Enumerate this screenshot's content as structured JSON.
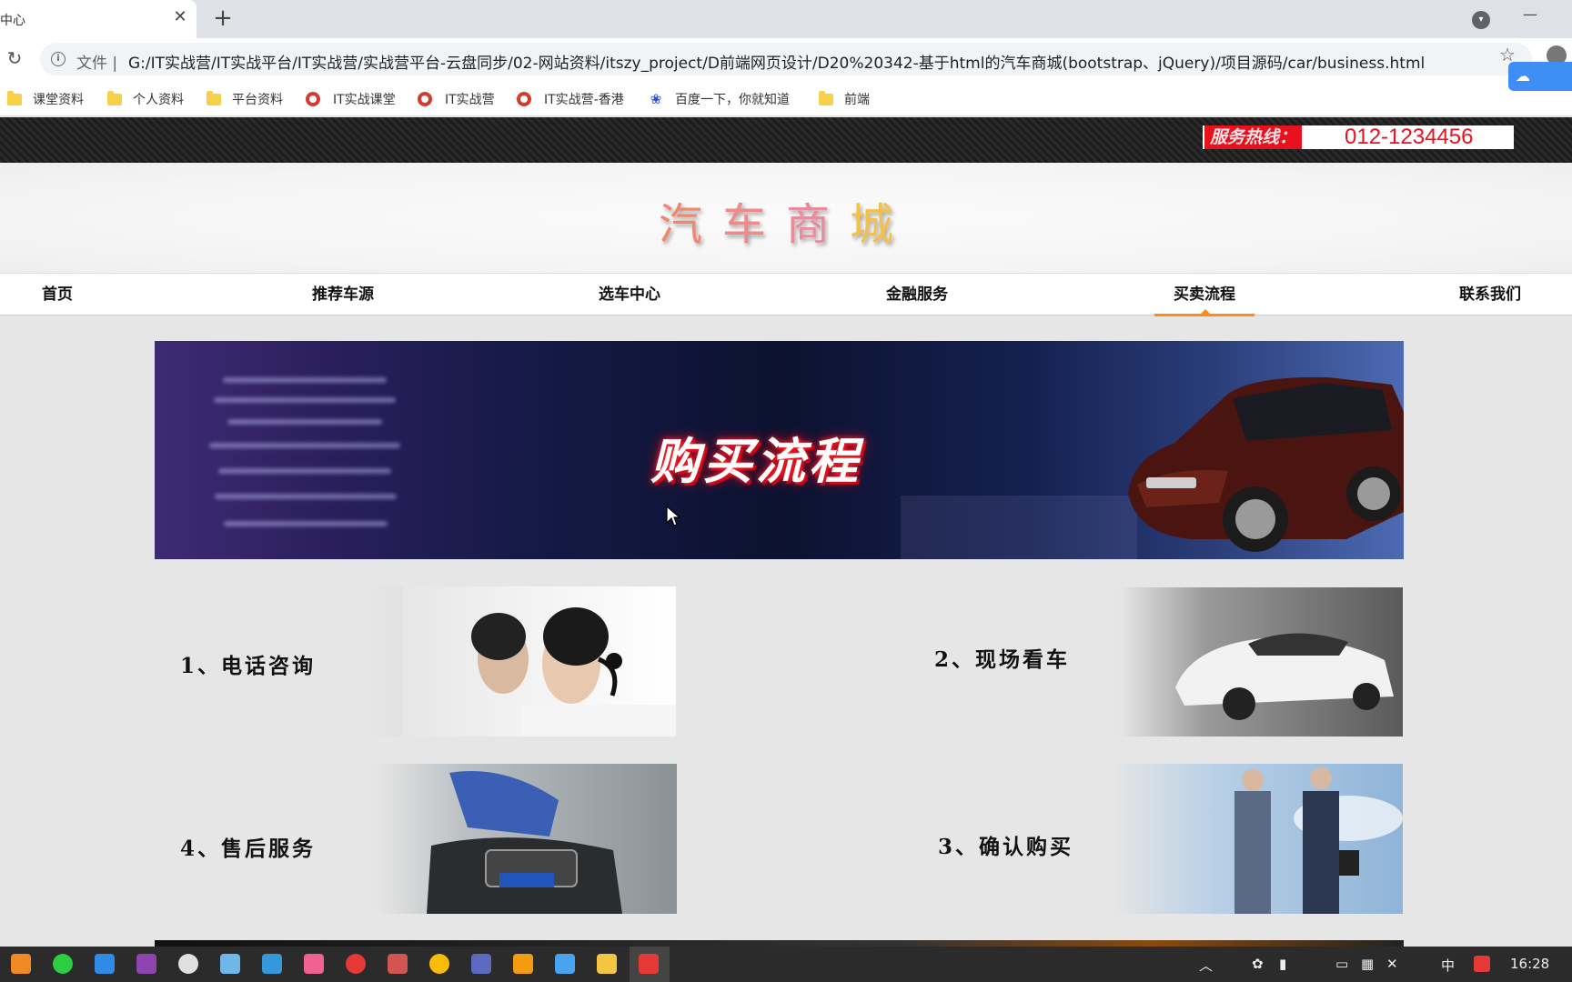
{
  "browser": {
    "tab_title": "中心",
    "tab_close": "✕",
    "new_tab": "+",
    "url_scheme": "文件 |",
    "url": "G:/IT实战营/IT实战平台/IT实战营/实战营平台-云盘同步/02-网站资料/itszy_project/D前端网页设计/D20%20342-基于html的汽车商城(bootstrap、jQuery)/项目源码/car/business.html",
    "bookmarks": [
      {
        "label": "课堂资料",
        "icon": "folder-icon"
      },
      {
        "label": "个人资料",
        "icon": "folder-icon"
      },
      {
        "label": "平台资料",
        "icon": "folder-icon"
      },
      {
        "label": "IT实战课堂",
        "icon": "site-icon"
      },
      {
        "label": "IT实战营",
        "icon": "site-icon"
      },
      {
        "label": "IT实战营-香港",
        "icon": "site-icon"
      },
      {
        "label": "百度一下，你就知道",
        "icon": "baidu-icon"
      },
      {
        "label": "前端",
        "icon": "folder-icon"
      }
    ]
  },
  "site": {
    "hotline_label": "服务热线：",
    "hotline_number": "012-1234456",
    "logo": [
      "汽",
      "车",
      "商",
      "城"
    ],
    "logo_colors": [
      "#f0876e",
      "#f08a8a",
      "#e98b9c",
      "#f3c04a"
    ],
    "nav": [
      "首页",
      "推荐车源",
      "选车中心",
      "金融服务",
      "买卖流程",
      "联系我们"
    ],
    "active_nav": "买卖流程",
    "banner_title": "购买流程",
    "steps": [
      {
        "label": "1、电话咨询"
      },
      {
        "label": "2、现场看车"
      },
      {
        "label": "4、售后服务"
      },
      {
        "label": "3、确认购买"
      }
    ]
  },
  "taskbar": {
    "time": "16:28",
    "ime": "中"
  },
  "colors": {
    "accent": "#ff8c1a",
    "hotline_red": "#e8121f"
  }
}
